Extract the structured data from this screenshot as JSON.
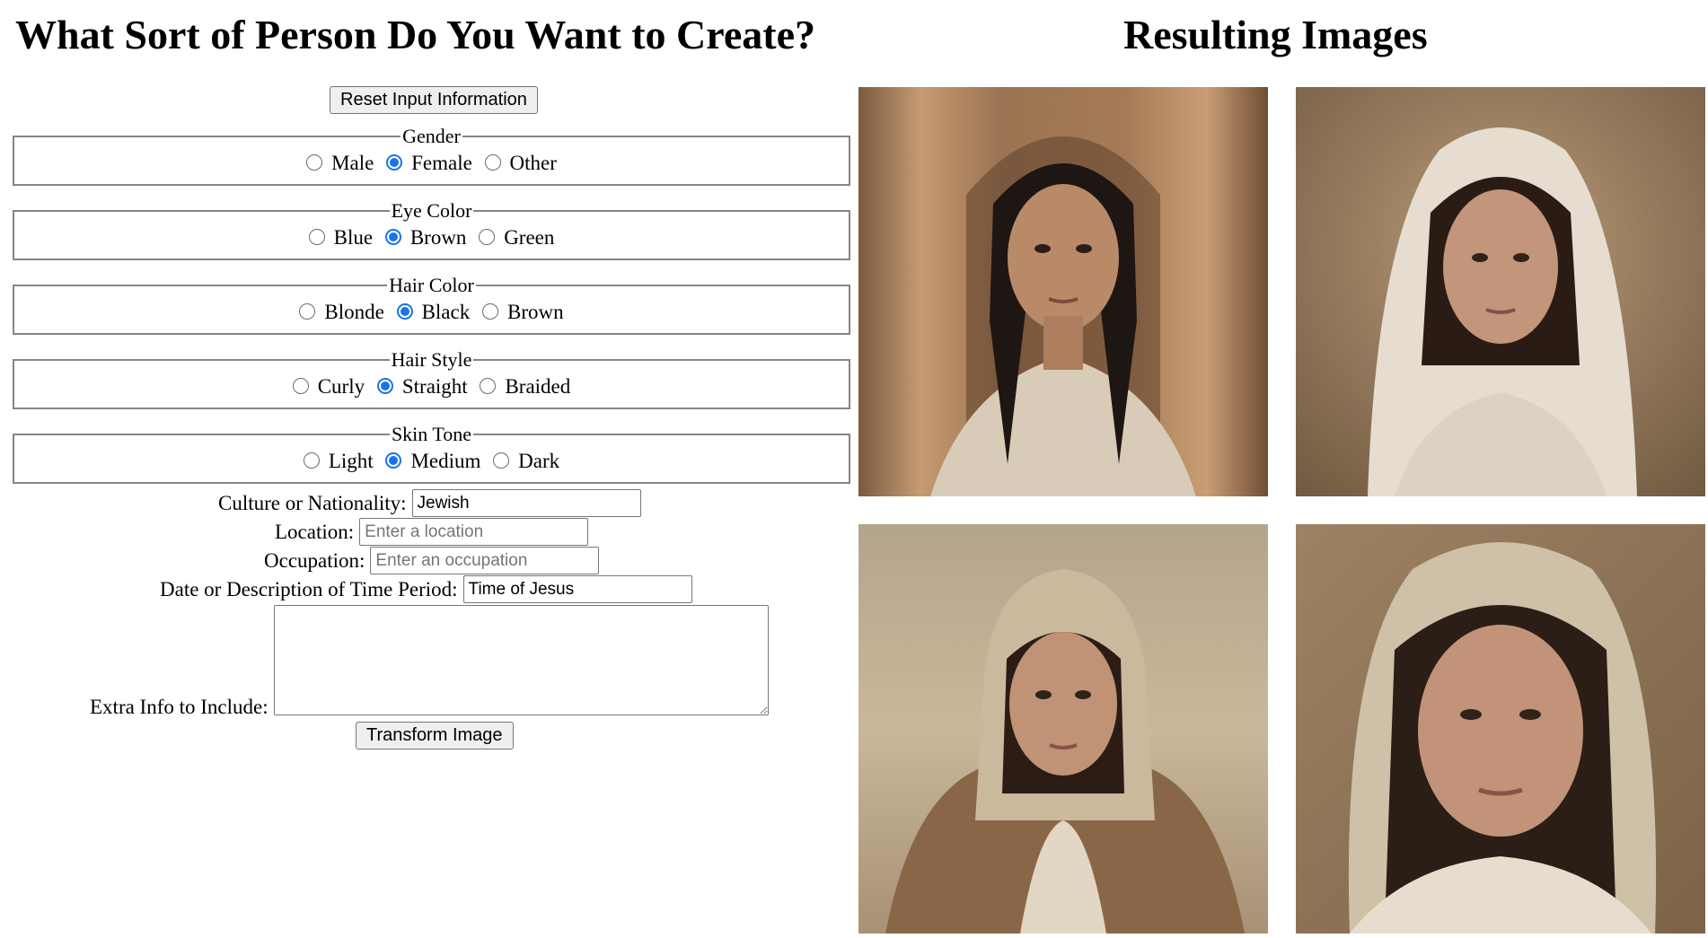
{
  "form": {
    "title": "What Sort of Person Do You Want to Create?",
    "reset_label": "Reset Input Information",
    "groups": [
      {
        "legend": "Gender",
        "options": [
          "Male",
          "Female",
          "Other"
        ],
        "selected": "Female"
      },
      {
        "legend": "Eye Color",
        "options": [
          "Blue",
          "Brown",
          "Green"
        ],
        "selected": "Brown"
      },
      {
        "legend": "Hair Color",
        "options": [
          "Blonde",
          "Black",
          "Brown"
        ],
        "selected": "Black"
      },
      {
        "legend": "Hair Style",
        "options": [
          "Curly",
          "Straight",
          "Braided"
        ],
        "selected": "Straight"
      },
      {
        "legend": "Skin Tone",
        "options": [
          "Light",
          "Medium",
          "Dark"
        ],
        "selected": "Medium"
      }
    ],
    "culture_label": "Culture or Nationality:",
    "culture_value": "Jewish",
    "location_label": "Location:",
    "location_placeholder": "Enter a location",
    "occupation_label": "Occupation:",
    "occupation_placeholder": "Enter an occupation",
    "date_label": "Date or Description of Time Period:",
    "date_value": "Time of Jesus",
    "extra_label": "Extra Info to Include:",
    "extra_value": "",
    "transform_label": "Transform Image"
  },
  "results": {
    "title": "Resulting Images"
  }
}
